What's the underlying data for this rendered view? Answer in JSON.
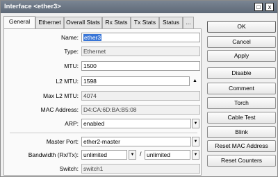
{
  "window": {
    "title": "Interface <ether3>",
    "restore_glyph": "□",
    "close_glyph": "x"
  },
  "tabs": [
    "General",
    "Ethernet",
    "Overall Stats",
    "Rx Stats",
    "Tx Stats",
    "Status",
    "..."
  ],
  "form": {
    "name": {
      "label": "Name:",
      "value": "ether3"
    },
    "type": {
      "label": "Type:",
      "value": "Ethernet"
    },
    "mtu": {
      "label": "MTU:",
      "value": "1500"
    },
    "l2mtu": {
      "label": "L2 MTU:",
      "value": "1598"
    },
    "max_l2mtu": {
      "label": "Max L2 MTU:",
      "value": "4074"
    },
    "mac": {
      "label": "MAC Address:",
      "value": "D4:CA:6D:BA:B5:08"
    },
    "arp": {
      "label": "ARP:",
      "value": "enabled"
    },
    "master_port": {
      "label": "Master Port:",
      "value": "ether2-master"
    },
    "bandwidth": {
      "label": "Bandwidth (Rx/Tx):",
      "rx": "unlimited",
      "separator": "/",
      "tx": "unlimited"
    },
    "switch": {
      "label": "Switch:",
      "value": "switch1"
    }
  },
  "buttons": [
    "OK",
    "Cancel",
    "Apply",
    "Disable",
    "Comment",
    "Torch",
    "Cable Test",
    "Blink",
    "Reset MAC Address",
    "Reset Counters"
  ],
  "icons": {
    "dropdown": "dropdown-triangle",
    "spinner": "up-triangle"
  },
  "colors": {
    "titlebar": "#6b7683",
    "selection": "#3875d7",
    "panel": "#fafafa",
    "window": "#f0f0f0"
  }
}
